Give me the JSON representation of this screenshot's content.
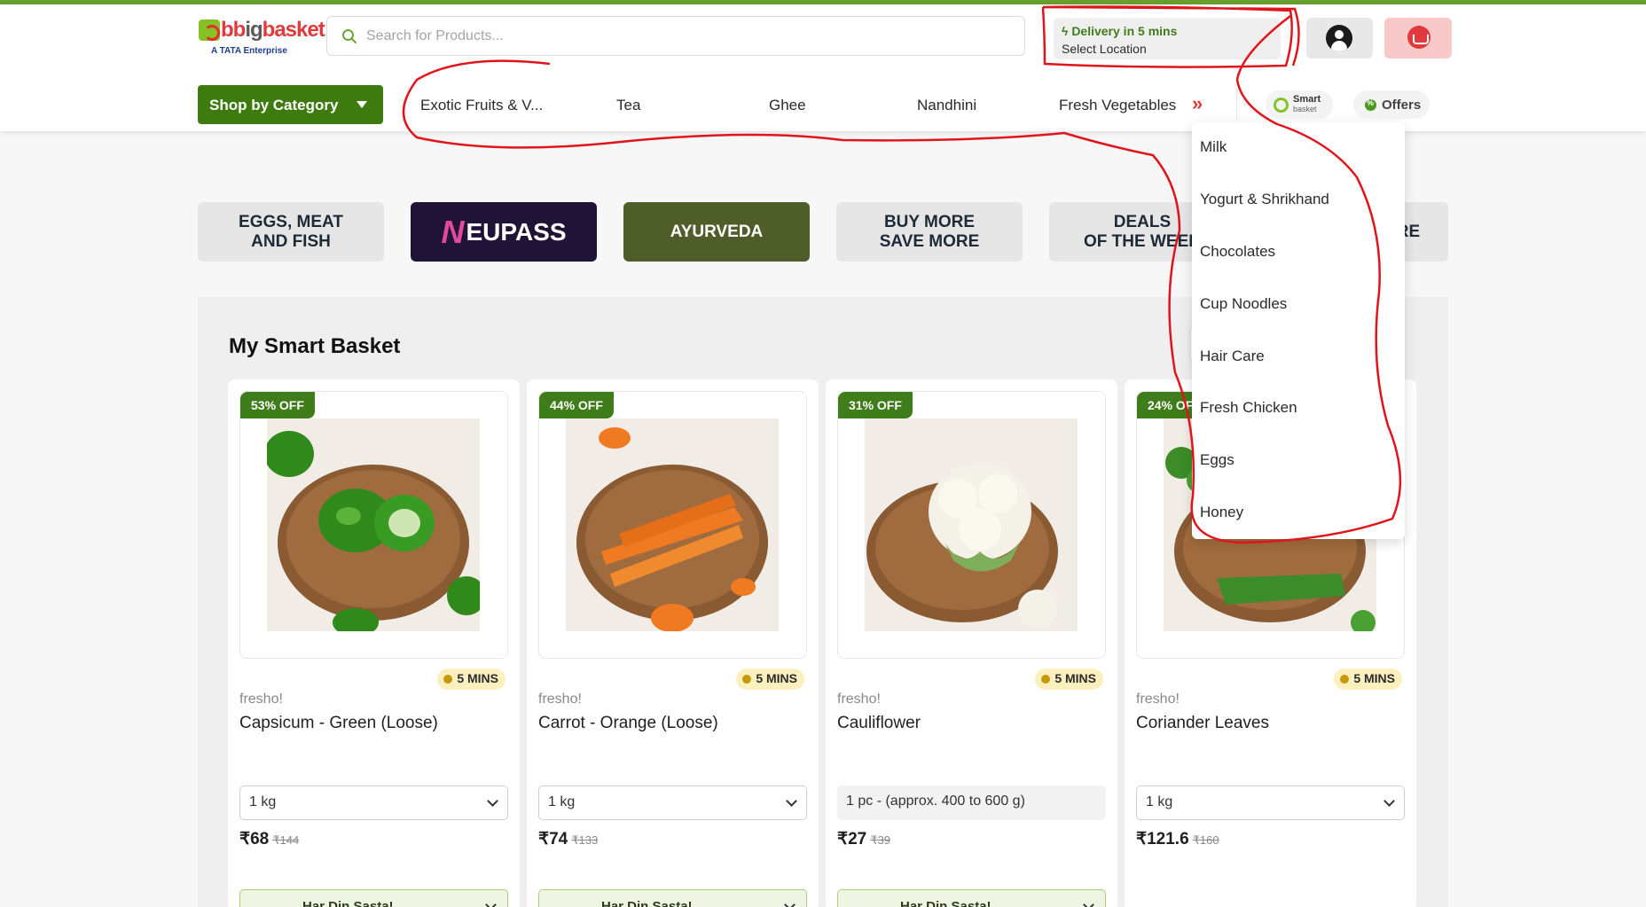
{
  "header": {
    "logo_text_1": "bb",
    "logo_text_2": "bigbasket",
    "logo_tagline": "A TATA Enterprise",
    "search_placeholder": "Search for Products...",
    "delivery_title": "Delivery in 5 mins",
    "delivery_location": "Select Location"
  },
  "nav": {
    "shop_by_category": "Shop by Category",
    "quick_links": [
      "Exotic Fruits & V...",
      "Tea",
      "Ghee",
      "Nandhini",
      "Fresh Vegetables"
    ],
    "more_icon": "»",
    "smart_basket_line1": "Smart",
    "smart_basket_line2": "basket",
    "offers": "Offers"
  },
  "dropdown": {
    "items": [
      "Milk",
      "Yogurt & Shrikhand",
      "Chocolates",
      "Cup Noodles",
      "Hair Care",
      "Fresh Chicken",
      "Eggs",
      "Honey"
    ]
  },
  "tiles": [
    {
      "line1": "EGGS, MEAT",
      "line2": "AND FISH"
    },
    {
      "n": "N",
      "text": "EUPASS"
    },
    {
      "line1": "AYURVEDA",
      "line2": ""
    },
    {
      "line1": "BUY MORE",
      "line2": "SAVE MORE"
    },
    {
      "line1": "DEALS",
      "line2": "OF THE WEEK"
    },
    {
      "line1": "RE",
      "line2": ""
    }
  ],
  "section": {
    "title": "My Smart Basket"
  },
  "products": [
    {
      "discount": "53% OFF",
      "eta": "5 MINS",
      "brand": "fresho!",
      "name": "Capsicum - Green (Loose)",
      "qty": "1 kg",
      "price": "₹68",
      "mrp": "₹144",
      "cta": "Har Din Sasta!"
    },
    {
      "discount": "44% OFF",
      "eta": "5 MINS",
      "brand": "fresho!",
      "name": "Carrot - Orange (Loose)",
      "qty": "1 kg",
      "price": "₹74",
      "mrp": "₹133",
      "cta": "Har Din Sasta!"
    },
    {
      "discount": "31% OFF",
      "eta": "5 MINS",
      "brand": "fresho!",
      "name": "Cauliflower",
      "qty": "1 pc - (approx. 400 to 600 g)",
      "price": "₹27",
      "mrp": "₹39",
      "cta": "Har Din Sasta!"
    },
    {
      "discount": "24% OFF",
      "eta": "5 MINS",
      "brand": "fresho!",
      "name": "Coriander Leaves",
      "qty": "1 kg",
      "price": "₹121.6",
      "mrp": "₹160",
      "cta": "Har Din Sasta!"
    }
  ],
  "colors": {
    "brand_green": "#3d7b0f",
    "brand_red": "#e03a3c",
    "annotation_red": "#e0151b"
  }
}
